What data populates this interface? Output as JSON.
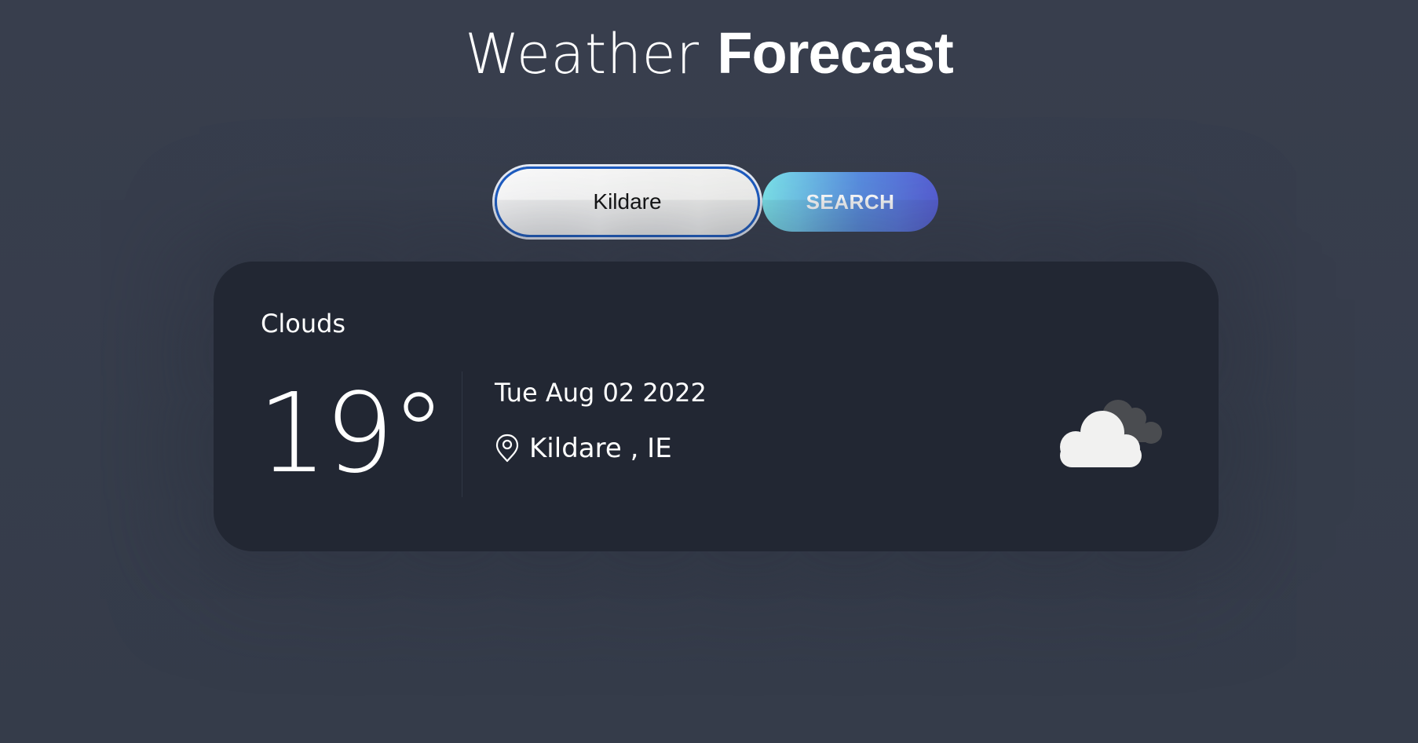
{
  "header": {
    "title_light": "Weather",
    "title_bold": "Forecast"
  },
  "search": {
    "input_value": "Kildare",
    "button_label": "SEARCH"
  },
  "weather_card": {
    "condition": "Clouds",
    "temperature": "19°",
    "date": "Tue Aug 02 2022",
    "location": "Kildare , IE",
    "location_icon": "map-pin-icon",
    "weather_icon": "cloudy-icon"
  },
  "colors": {
    "background": "#373e4c",
    "card": "#222733",
    "button_gradient_start": "#7ee8ef",
    "button_gradient_end": "#5860d8",
    "input_focus_border": "#1d5dc4"
  }
}
